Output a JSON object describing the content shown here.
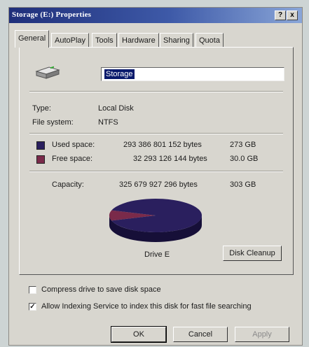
{
  "window": {
    "title": "Storage (E:) Properties",
    "help_label": "?",
    "close_label": "x"
  },
  "tabs": [
    {
      "label": "General"
    },
    {
      "label": "AutoPlay"
    },
    {
      "label": "Tools"
    },
    {
      "label": "Hardware"
    },
    {
      "label": "Sharing"
    },
    {
      "label": "Quota"
    }
  ],
  "general": {
    "drive_name": "Storage",
    "type_label": "Type:",
    "type_value": "Local Disk",
    "fs_label": "File system:",
    "fs_value": "NTFS",
    "used_label": "Used space:",
    "used_bytes": "293 386 801 152 bytes",
    "used_gb": "273 GB",
    "free_label": "Free space:",
    "free_bytes": "32 293 126 144 bytes",
    "free_gb": "30.0 GB",
    "capacity_label": "Capacity:",
    "capacity_bytes": "325 679 927 296 bytes",
    "capacity_gb": "303 GB",
    "drive_caption": "Drive E",
    "cleanup_label": "Disk Cleanup",
    "compress_label": "Compress drive to save disk space",
    "compress_checked": false,
    "index_label": "Allow Indexing Service to index this disk for fast file searching",
    "index_checked": true
  },
  "colors": {
    "used": "#2a1f5e",
    "free": "#7a2a4a"
  },
  "chart_data": {
    "type": "pie",
    "categories": [
      "Used space",
      "Free space"
    ],
    "values": [
      293386801152,
      32293126144
    ]
  },
  "buttons": {
    "ok_label": "OK",
    "cancel_label": "Cancel",
    "apply_label": "Apply"
  }
}
